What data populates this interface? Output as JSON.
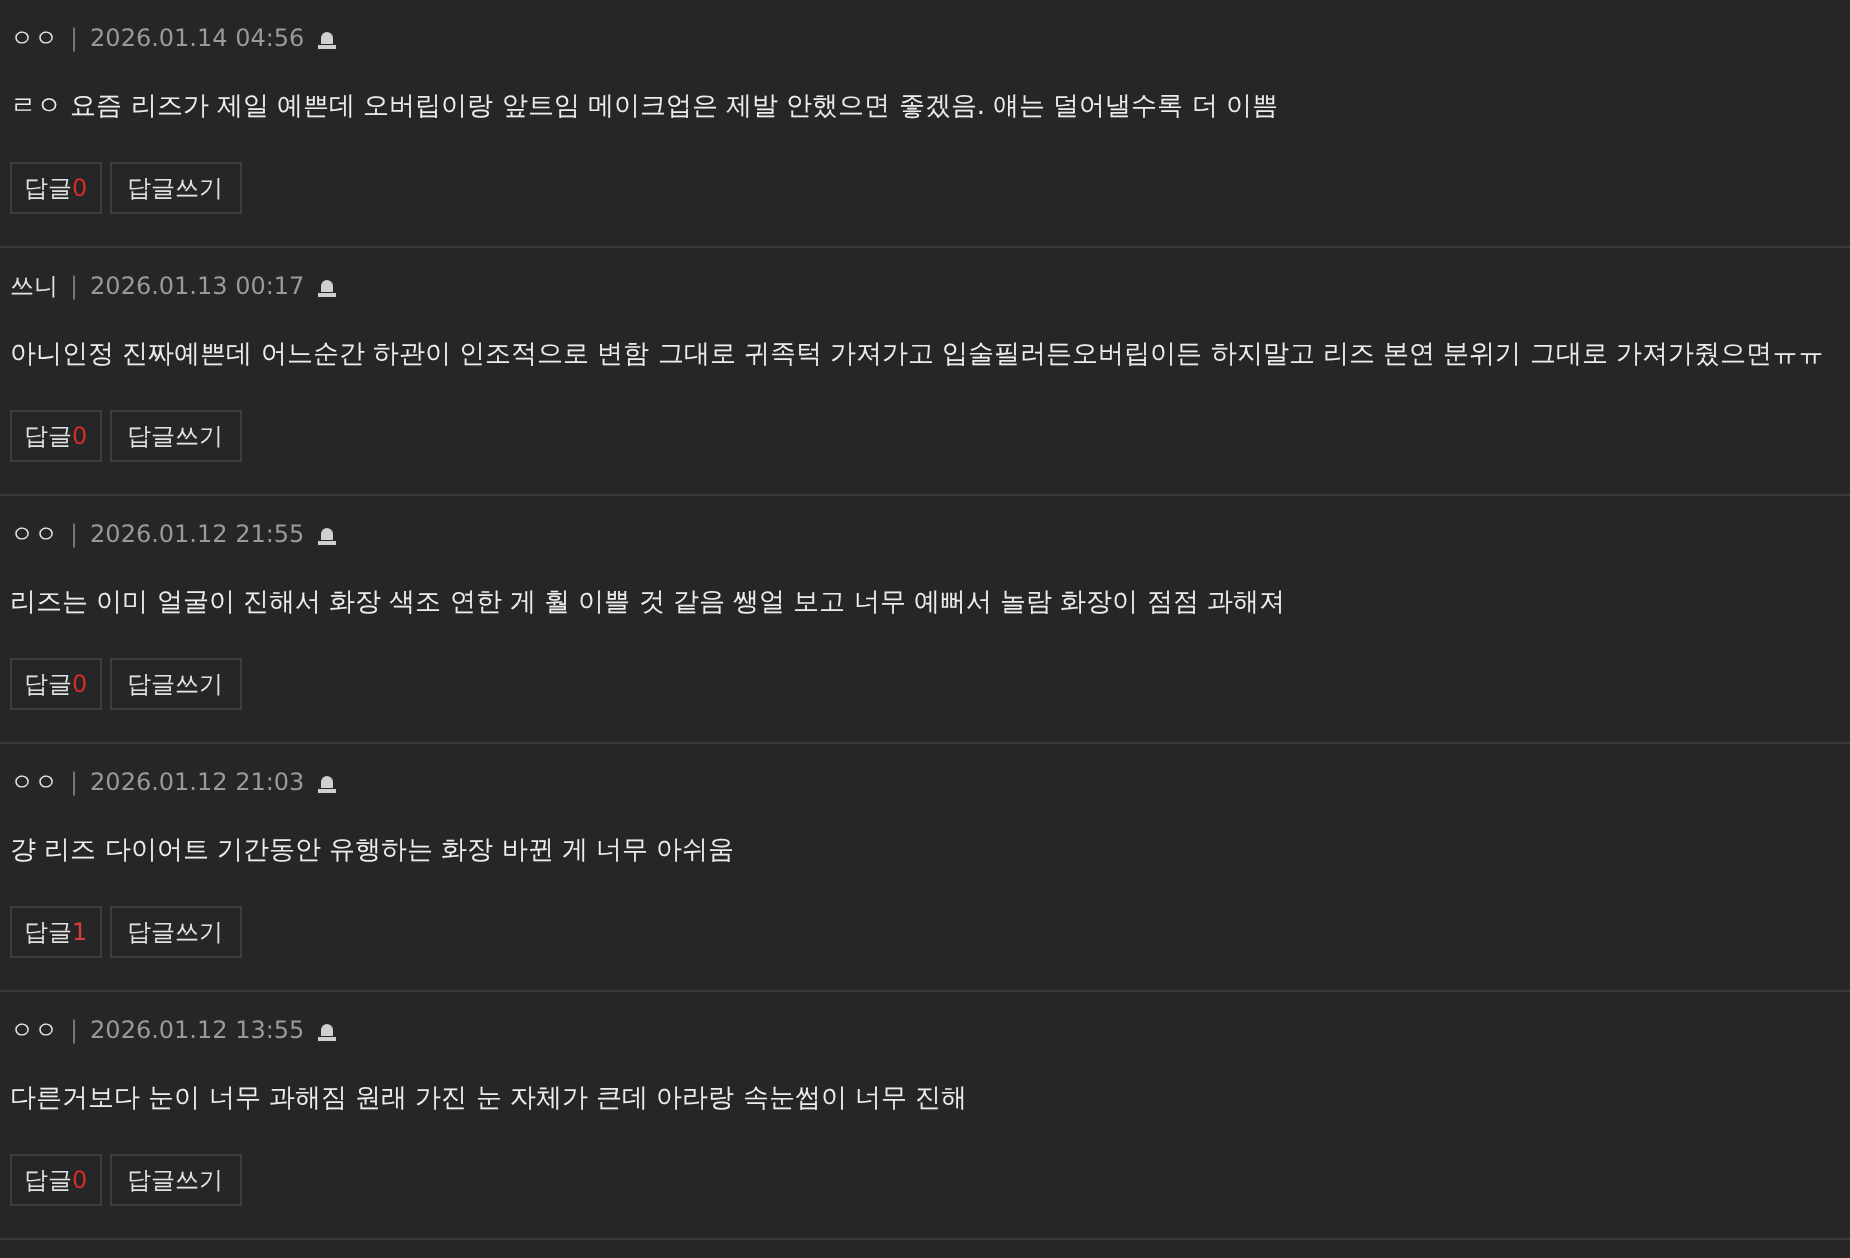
{
  "comments": [
    {
      "author": "ㅇㅇ",
      "separator": "|",
      "date": "2026.01.14 04:56",
      "text": "ㄹㅇ 요즘 리즈가 제일 예쁜데 오버립이랑 앞트임 메이크업은 제발 안했으면 좋겠음. 얘는 덜어낼수록 더 이쁨",
      "reply_label": "답글",
      "reply_count": "0",
      "write_label": "답글쓰기"
    },
    {
      "author": "쓰니",
      "separator": "|",
      "date": "2026.01.13 00:17",
      "text": "아니인정 진짜예쁜데 어느순간 하관이 인조적으로 변함 그대로 귀족턱 가져가고 입술필러든오버립이든 하지말고 리즈 본연 분위기 그대로 가져가줬으면ㅠㅠ",
      "reply_label": "답글",
      "reply_count": "0",
      "write_label": "답글쓰기"
    },
    {
      "author": "ㅇㅇ",
      "separator": "|",
      "date": "2026.01.12 21:55",
      "text": "리즈는 이미 얼굴이 진해서 화장 색조 연한 게 훨 이쁠 것 같음 쌩얼 보고 너무 예뻐서 놀람 화장이 점점 과해져",
      "reply_label": "답글",
      "reply_count": "0",
      "write_label": "답글쓰기"
    },
    {
      "author": "ㅇㅇ",
      "separator": "|",
      "date": "2026.01.12 21:03",
      "text": "걍 리즈 다이어트 기간동안 유행하는 화장 바뀐 게 너무 아쉬움",
      "reply_label": "답글",
      "reply_count": "1",
      "write_label": "답글쓰기"
    },
    {
      "author": "ㅇㅇ",
      "separator": "|",
      "date": "2026.01.12 13:55",
      "text": "다른거보다 눈이 너무 과해짐 원래 가진 눈 자체가 큰데 아라랑 속눈썹이 너무 진해",
      "reply_label": "답글",
      "reply_count": "0",
      "write_label": "답글쓰기"
    }
  ]
}
